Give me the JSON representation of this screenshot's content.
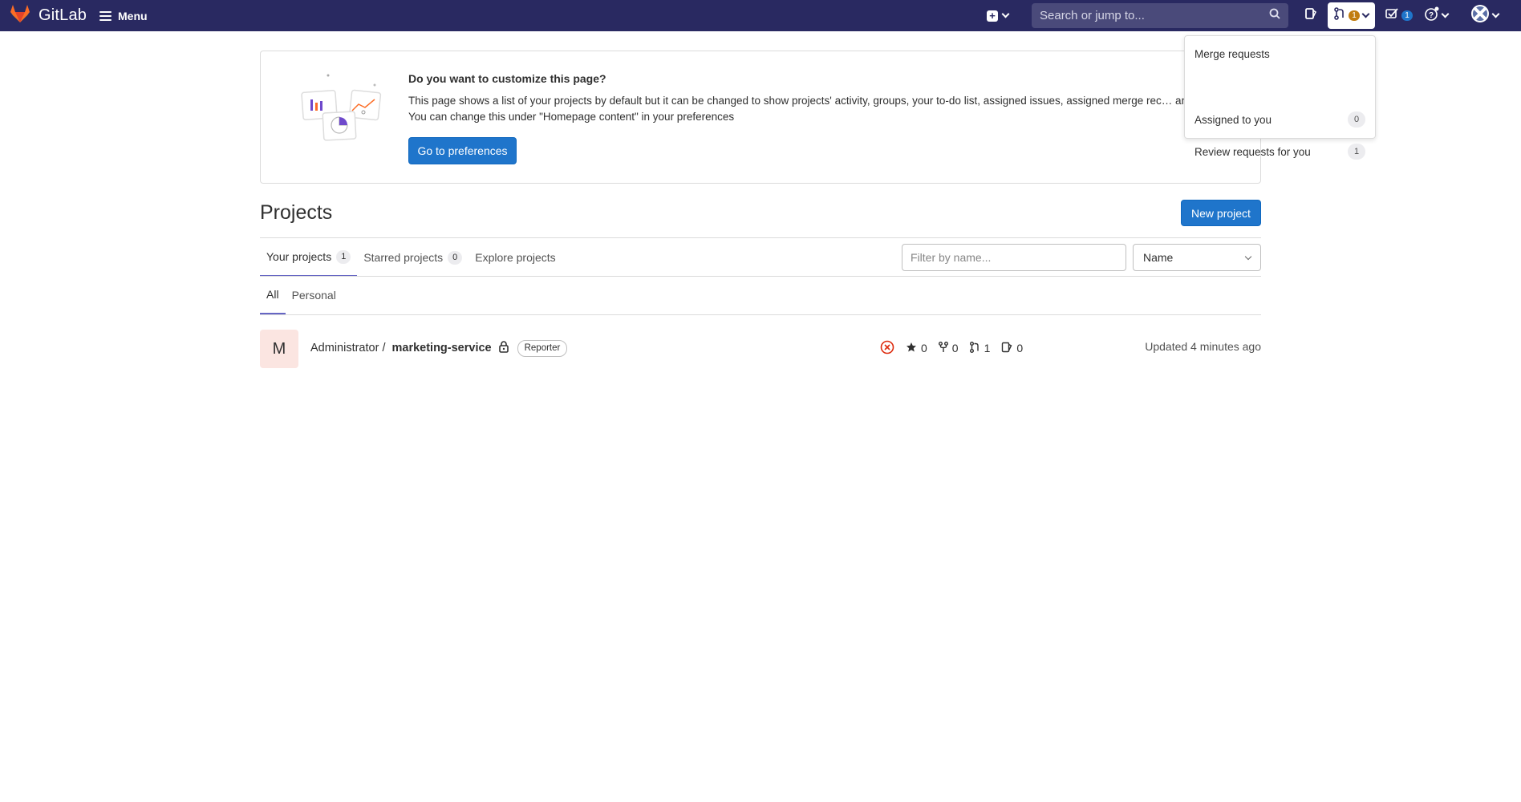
{
  "navbar": {
    "app_name": "GitLab",
    "menu_label": "Menu",
    "search_placeholder": "Search or jump to...",
    "merge_requests_count": "1",
    "todos_count": "1"
  },
  "promo": {
    "title": "Do you want to customize this page?",
    "body": "This page shows a list of your projects by default but it can be changed to show projects' activity, groups, your to-do list, assigned issues, assigned merge rec… and more. You can change this under \"Homepage content\" in your preferences",
    "button_label": "Go to preferences"
  },
  "merge_requests_dropdown": {
    "header": "Merge requests",
    "items": [
      {
        "label": "Assigned to you",
        "count": "0"
      },
      {
        "label": "Review requests for you",
        "count": "1"
      }
    ]
  },
  "projects": {
    "title": "Projects",
    "new_project_label": "New project",
    "tabs": [
      {
        "label": "Your projects",
        "count": "1"
      },
      {
        "label": "Starred projects",
        "count": "0"
      },
      {
        "label": "Explore projects",
        "count": ""
      }
    ],
    "filter_placeholder": "Filter by name...",
    "sort_value": "Name",
    "subtabs": [
      "All",
      "Personal"
    ],
    "list": [
      {
        "avatar_letter": "M",
        "namespace": "Administrator /",
        "name": "marketing-service",
        "role": "Reporter",
        "stars": "0",
        "forks": "0",
        "merge_requests": "1",
        "issues": "0",
        "updated": "Updated 4 minutes ago"
      }
    ]
  },
  "colors": {
    "navbar_bg": "#292961",
    "primary": "#1f75cb",
    "tab_active_border": "#6666c4",
    "mr_badge": "#c17d10",
    "pipeline_failed": "#dd2b0e"
  }
}
